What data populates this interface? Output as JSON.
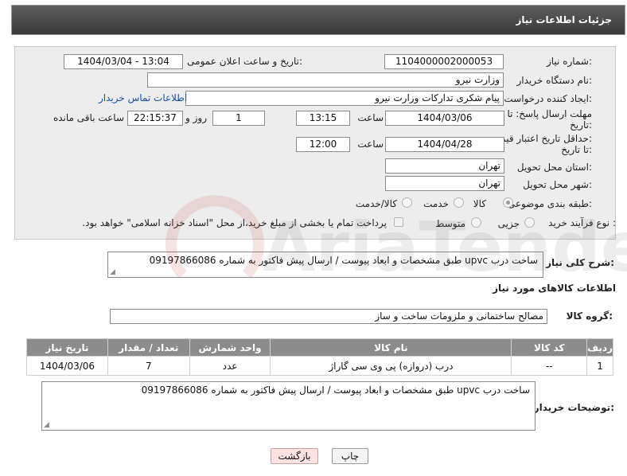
{
  "header": {
    "title": "جزئیات اطلاعات نیاز"
  },
  "form": {
    "need_number_label": "شماره نیاز:",
    "need_number": "1104000002000053",
    "announce_label": "تاریخ و ساعت اعلان عمومی:",
    "announce_value": "1404/03/04 - 13:04",
    "buyer_org_label": "نام دستگاه خریدار:",
    "buyer_org": "وزارت نیرو",
    "requester_label": "ایجاد کننده درخواست:",
    "requester": "پیام شکری تدارکات وزارت نیرو",
    "contact_link": "اطلاعات تماس خریدار",
    "deadline_label_1": "مهلت ارسال پاسخ: تا",
    "deadline_label_2": "تاریخ:",
    "deadline_date": "1404/03/06",
    "time_label": "ساعت",
    "deadline_time": "13:15",
    "days_value": "1",
    "days_label": "روز و",
    "remaining_time": "22:15:37",
    "remaining_label": "ساعت باقی مانده",
    "validity_label_1": "حداقل تاریخ اعتبار قیمت:",
    "validity_label_2": "تا تاریخ:",
    "validity_date": "1404/04/28",
    "validity_time": "12:00",
    "province_label": "استان محل تحویل:",
    "province": "تهران",
    "city_label": "شهر محل تحویل:",
    "city": "تهران",
    "category_label": "طبقه بندی موضوعی:",
    "category_options": [
      "کالا",
      "خدمت",
      "کالا/خدمت"
    ],
    "category_selected": "کالا",
    "process_label": "نوع فرآیند خرید :",
    "process_options": [
      "جزیی",
      "متوسط"
    ],
    "payment_note": "پرداخت تمام یا بخشی از مبلغ خرید،از محل \"اسناد خزانه اسلامی\" خواهد بود."
  },
  "description": {
    "label": "شرح کلی نیاز:",
    "text": "ساخت درب upvc طبق مشخصات و ابعاد پیوست / ارسال پیش فاکتور به شماره 09197866086"
  },
  "goods": {
    "section_title": "اطلاعات کالاهای مورد نیاز",
    "group_label": "گروه کالا:",
    "group_value": "مصالح ساختمانی و ملزومات ساخت و ساز",
    "columns": [
      "ردیف",
      "کد کالا",
      "نام کالا",
      "واحد شمارش",
      "تعداد / مقدار",
      "تاریخ نیاز"
    ],
    "rows": [
      {
        "index": "1",
        "code": "--",
        "name": "درب (دروازه) پی وی سی گاراژ",
        "unit": "عدد",
        "qty": "7",
        "date": "1404/03/06"
      }
    ]
  },
  "buyer_notes": {
    "label": "توضیحات خریدار:",
    "text": "ساخت درب upvc طبق مشخصات و ابعاد پیوست / ارسال پیش فاکتور به شماره 09197866086"
  },
  "buttons": {
    "print": "چاپ",
    "back": "بازگشت"
  },
  "watermark": {
    "text": "AriaTender.net"
  },
  "colors": {
    "header_bg": "#4a4a4a",
    "panel_bg": "#ededed",
    "table_header_bg": "#8c8c8c",
    "back_button_bg": "#fde2e2",
    "link": "#1a4ea8"
  }
}
